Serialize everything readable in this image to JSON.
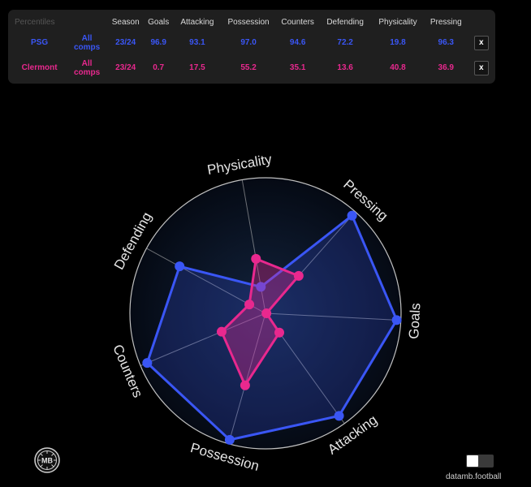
{
  "table": {
    "header": [
      "Percentiles",
      "Season",
      "Goals",
      "Attacking",
      "Possession",
      "Counters",
      "Defending",
      "Physicality",
      "Pressing"
    ],
    "rows": [
      {
        "team": "PSG",
        "comp": [
          "All",
          "comps"
        ],
        "season": "23/24",
        "goals": "96.9",
        "attacking": "93.1",
        "possession": "97.0",
        "counters": "94.6",
        "defending": "72.2",
        "physicality": "19.8",
        "pressing": "96.3",
        "close": "x"
      },
      {
        "team": "Clermont",
        "comp": [
          "All",
          "comps"
        ],
        "season": "23/24",
        "goals": "0.7",
        "attacking": "17.5",
        "possession": "55.2",
        "counters": "35.1",
        "defending": "13.6",
        "physicality": "40.8",
        "pressing": "36.9",
        "close": "x"
      }
    ]
  },
  "colors": {
    "psg": "#3a56f5",
    "clermont": "#e8288e",
    "grid": "#bfbfbf",
    "panel": "#1f1f1f"
  },
  "chart_data": {
    "type": "radar",
    "axes": [
      "Physicality",
      "Pressing",
      "Goals",
      "Attacking",
      "Possession",
      "Counters",
      "Defending"
    ],
    "range": [
      0,
      100
    ],
    "series": [
      {
        "name": "PSG",
        "values": [
          19.8,
          96.3,
          96.9,
          93.1,
          97.0,
          94.6,
          72.2
        ]
      },
      {
        "name": "Clermont",
        "values": [
          40.8,
          36.9,
          0.7,
          17.5,
          55.2,
          35.1,
          13.6
        ]
      }
    ]
  },
  "logo": {
    "text": "MB",
    "icon": "datamb-logo-icon"
  },
  "toggle": {
    "state": "off"
  },
  "credit": "datamb.football"
}
